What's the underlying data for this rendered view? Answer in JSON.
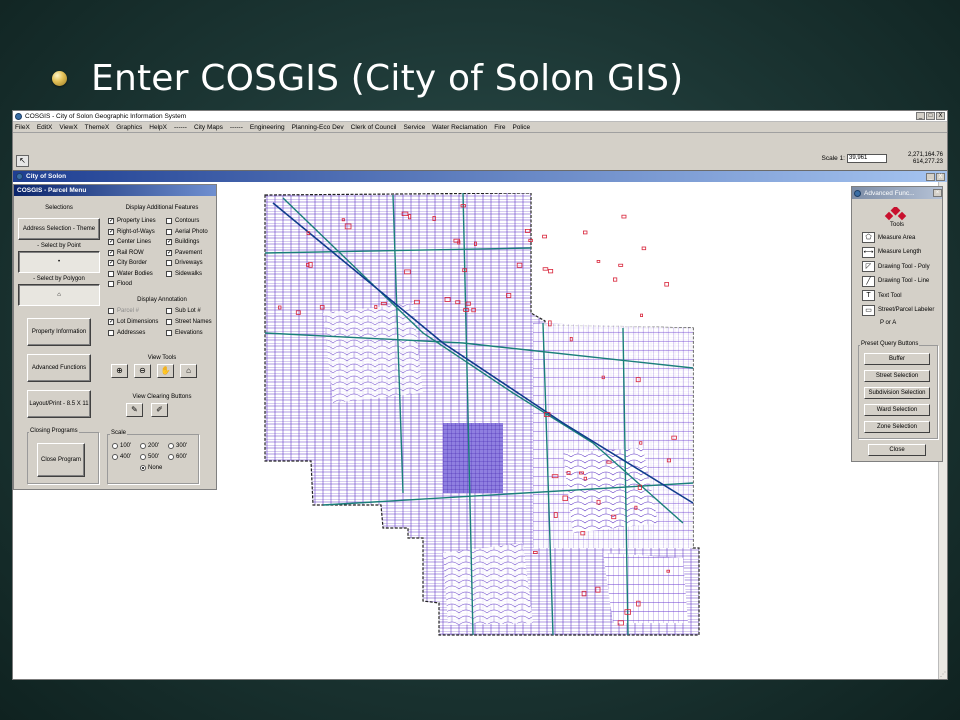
{
  "slide": {
    "title": "Enter COSGIS (City of Solon GIS)"
  },
  "app": {
    "title": "COSGIS - City of Solon Geographic Information System",
    "window_buttons": [
      "_",
      "□",
      "X"
    ],
    "menu": [
      "FileX",
      "EditX",
      "ViewX",
      "ThemeX",
      "Graphics",
      "HelpX",
      "------",
      "City Maps",
      "------",
      "Engineering",
      "Planning-Eco Dev",
      "Clerk of Council",
      "Service",
      "Water Reclamation",
      "Fire",
      "Police"
    ],
    "scale_label": "Scale 1:",
    "scale_value": "39,961",
    "coord_x": "2,271,164.76",
    "coord_y": "614,277.23"
  },
  "child": {
    "title": "City of Solon",
    "window_buttons": [
      "_",
      "X"
    ]
  },
  "parcel_menu": {
    "title": "COSGIS - Parcel Menu",
    "selections_label": "Selections",
    "address_btn": "Address Selection - Theme",
    "select_point_label": "- Select by Point",
    "select_polygon_label": "- Select by Polygon",
    "property_info_btn": "Property Information",
    "advanced_btn": "Advanced Functions",
    "layout_btn": "Layout/Print - 8.5 X 11",
    "closing_label": "Closing Programs",
    "close_program_btn": "Close Program",
    "display_features_label": "Display Additional Features",
    "features_left": [
      {
        "label": "Property Lines",
        "checked": true
      },
      {
        "label": "Right-of-Ways",
        "checked": true
      },
      {
        "label": "Center Lines",
        "checked": true
      },
      {
        "label": "Rail ROW",
        "checked": true
      },
      {
        "label": "City Border",
        "checked": true
      },
      {
        "label": "Water Bodies",
        "checked": false
      },
      {
        "label": "Flood",
        "checked": false
      }
    ],
    "features_right": [
      {
        "label": "Contours",
        "checked": false
      },
      {
        "label": "Aerial Photo",
        "checked": false
      },
      {
        "label": "Buildings",
        "checked": true
      },
      {
        "label": "Pavement",
        "checked": true
      },
      {
        "label": "Driveways",
        "checked": false
      },
      {
        "label": "Sidewalks",
        "checked": false
      }
    ],
    "annotation_label": "Display Annotation",
    "annotation_left": [
      {
        "label": "Parcel #",
        "checked": false,
        "gray": true
      },
      {
        "label": "Lot Dimensions",
        "checked": true,
        "gray": false
      },
      {
        "label": "Addresses",
        "checked": false,
        "gray": false
      }
    ],
    "annotation_right": [
      {
        "label": "Sub Lot #",
        "checked": false
      },
      {
        "label": "Street Names",
        "checked": false
      },
      {
        "label": "Elevations",
        "checked": false
      }
    ],
    "view_tools_label": "View Tools",
    "view_clearing_label": "View Clearing Buttons",
    "scale_label": "Scale",
    "scale_options": [
      "100'",
      "200'",
      "300'",
      "400'",
      "500'",
      "600'",
      "None"
    ],
    "scale_selected": "None"
  },
  "advanced": {
    "title": "Advanced Func...",
    "close": "×",
    "tools_label": "Tools",
    "tools": [
      "Measure Area",
      "Measure Length",
      "Drawing Tool - Poly",
      "Drawing Tool - Line",
      "Text Tool",
      "Street/Parcel Labeler"
    ],
    "p_or_a": "P or A",
    "preset_label": "Preset Query Buttons",
    "queries": [
      "Buffer",
      "Street Selection",
      "Subdivision Selection",
      "Ward Selection",
      "Zone Selection"
    ],
    "close_btn": "Close"
  },
  "colors": {
    "parcel_lines": "#5a2fc4",
    "centerlines": "#1a7f7a",
    "buildings": "#d8243a"
  }
}
